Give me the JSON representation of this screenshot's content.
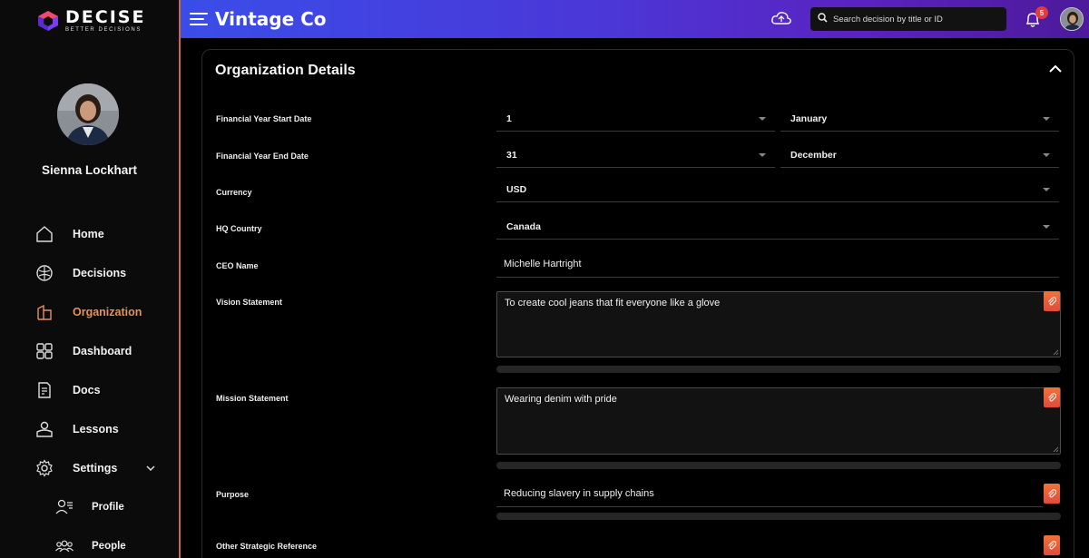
{
  "brand": {
    "name": "DECISE",
    "tagline": "BETTER DECISIONS"
  },
  "user": {
    "name": "Sienna Lockhart"
  },
  "nav": {
    "items": [
      {
        "label": "Home",
        "icon": "home-icon"
      },
      {
        "label": "Decisions",
        "icon": "brain-icon"
      },
      {
        "label": "Organization",
        "icon": "building-icon",
        "active": true
      },
      {
        "label": "Dashboard",
        "icon": "grid-icon"
      },
      {
        "label": "Docs",
        "icon": "document-icon"
      },
      {
        "label": "Lessons",
        "icon": "lessons-icon"
      },
      {
        "label": "Settings",
        "icon": "gear-icon"
      }
    ],
    "sub_items": [
      {
        "label": "Profile",
        "icon": "profile-icon"
      },
      {
        "label": "People",
        "icon": "people-icon"
      }
    ]
  },
  "header": {
    "title": "Vintage Co",
    "search_placeholder": "Search decision by title or ID",
    "notification_count": "5"
  },
  "card": {
    "title": "Organization Details",
    "fields": {
      "fy_start": {
        "label": "Financial Year Start Date",
        "day": "1",
        "month": "January"
      },
      "fy_end": {
        "label": "Financial Year End Date",
        "day": "31",
        "month": "December"
      },
      "currency": {
        "label": "Currency",
        "value": "USD"
      },
      "hq_country": {
        "label": "HQ Country",
        "value": "Canada"
      },
      "ceo_name": {
        "label": "CEO Name",
        "value": "Michelle Hartright"
      },
      "vision": {
        "label": "Vision Statement",
        "value": "To create cool jeans that fit everyone like a glove"
      },
      "mission": {
        "label": "Mission Statement",
        "value": "Wearing denim with pride"
      },
      "purpose": {
        "label": "Purpose",
        "value": "Reducing slavery in supply chains"
      },
      "other_strategic": {
        "label": "Other Strategic Reference"
      }
    }
  },
  "colors": {
    "accent": "#e8905a",
    "attach_button": "#e8573a",
    "header_gradient_start": "#3a4de8",
    "header_gradient_end": "#4c1a9a"
  }
}
